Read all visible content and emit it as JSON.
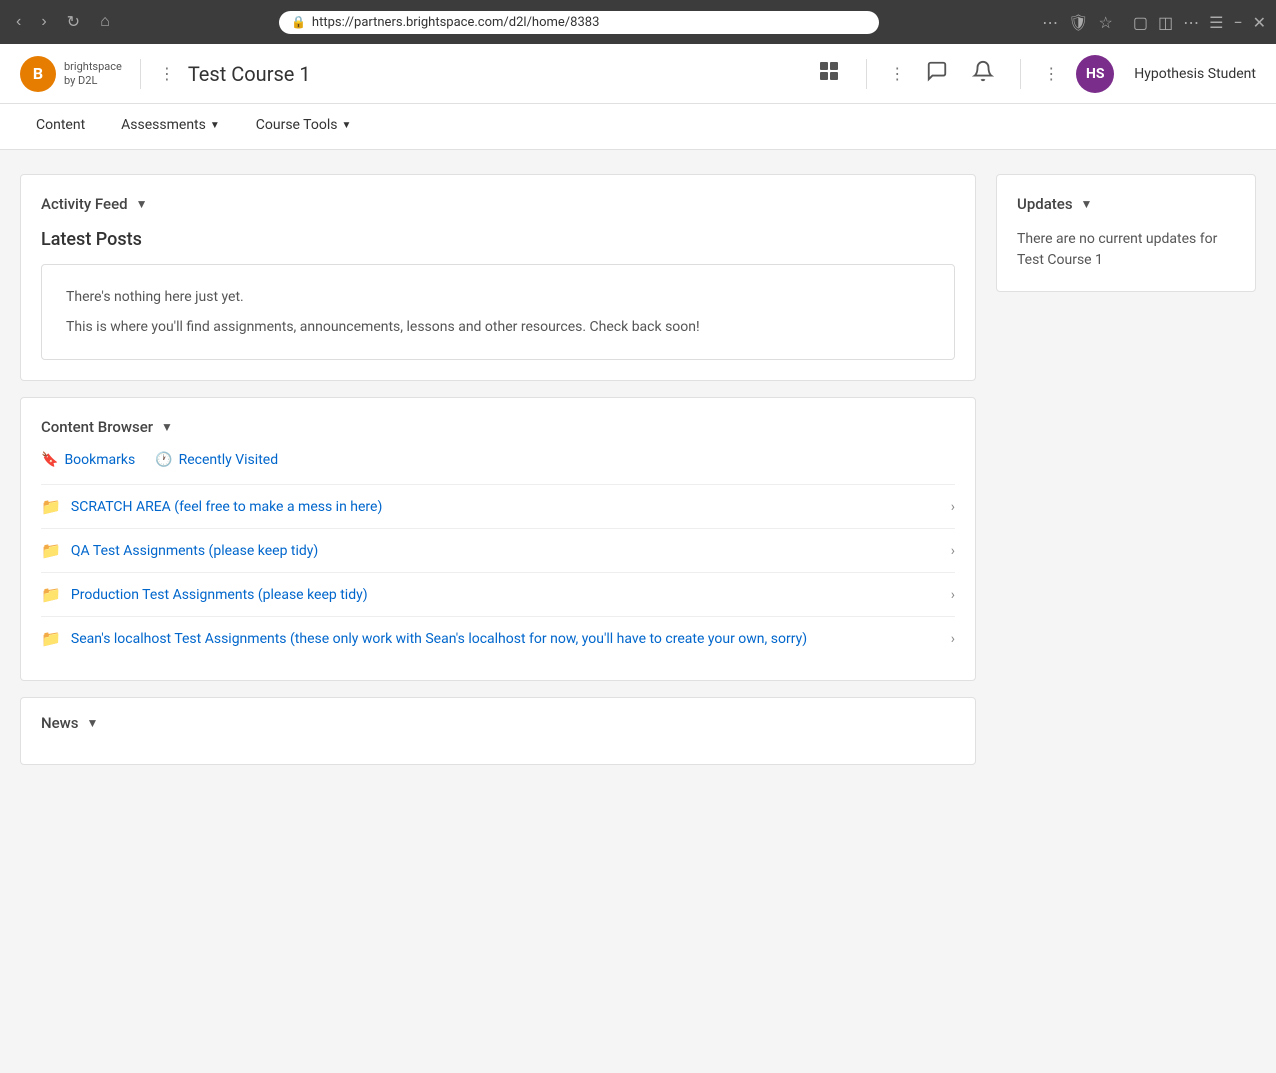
{
  "browser": {
    "url": "https://partners.brightspace.com/d2l/home/8383",
    "back_disabled": false,
    "forward_disabled": false
  },
  "header": {
    "logo_letter": "B",
    "logo_subtext": "brightspace\nby D2L",
    "course_title": "Test Course 1",
    "user_initials": "HS",
    "user_name": "Hypothesis Student",
    "grid_icon": "⊞",
    "chat_icon": "💬",
    "bell_icon": "🔔"
  },
  "nav": {
    "items": [
      {
        "label": "Content",
        "has_dropdown": false
      },
      {
        "label": "Assessments",
        "has_dropdown": true
      },
      {
        "label": "Course Tools",
        "has_dropdown": true
      }
    ]
  },
  "activity_feed": {
    "section_title": "Activity Feed",
    "latest_posts_title": "Latest Posts",
    "empty_line1": "There's nothing here just yet.",
    "empty_line2": "This is where you'll find assignments, announcements, lessons and other resources. Check back soon!"
  },
  "content_browser": {
    "section_title": "Content Browser",
    "tab_bookmarks": "Bookmarks",
    "tab_recently_visited": "Recently Visited",
    "items": [
      {
        "label": "SCRATCH AREA (feel free to make a mess in here)"
      },
      {
        "label": "QA Test Assignments (please keep tidy)"
      },
      {
        "label": "Production Test Assignments (please keep tidy)"
      },
      {
        "label": "Sean's localhost Test Assignments (these only work with Sean's localhost for now, you'll have to create your own, sorry)"
      }
    ]
  },
  "updates": {
    "section_title": "Updates",
    "no_updates_text": "There are no current updates for Test Course 1"
  },
  "news": {
    "section_title": "News"
  }
}
